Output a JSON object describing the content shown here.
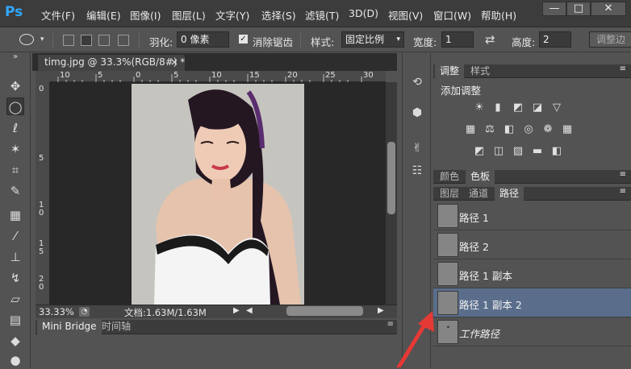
{
  "menubar": {
    "logo": "Ps",
    "items": [
      "文件(F)",
      "编辑(E)",
      "图像(I)",
      "图层(L)",
      "文字(Y)",
      "选择(S)",
      "滤镜(T)",
      "3D(D)",
      "视图(V)",
      "窗口(W)",
      "帮助(H)"
    ],
    "window_buttons": [
      "—",
      "□",
      "✕"
    ]
  },
  "options": {
    "feather_label": "羽化:",
    "feather_value": "0 像素",
    "antialias_label": "消除锯齿",
    "style_label": "样式:",
    "style_value": "固定比例",
    "width_label": "宽度:",
    "width_value": "1",
    "height_label": "高度:",
    "height_value": "2",
    "adjust_edge": "调整边"
  },
  "document": {
    "tab_title": "timg.jpg @ 33.3%(RGB/8#) *",
    "close": "×",
    "ruler_top": [
      "10",
      "5",
      "0",
      "5",
      "10",
      "15",
      "20",
      "25",
      "30"
    ],
    "ruler_left": [
      "0",
      "5",
      "1 0",
      "1 5",
      "2 0"
    ],
    "zoom": "33.33%",
    "doc_info": "文档:1.63M/1.63M"
  },
  "bottom_panel": {
    "tabs": [
      "Mini Bridge",
      "时间轴"
    ]
  },
  "adjust_panel": {
    "tabs": [
      "调整",
      "样式"
    ],
    "title": "添加调整"
  },
  "color_panel": {
    "tabs": [
      "颜色",
      "色板"
    ]
  },
  "paths_panel": {
    "tabs": [
      "图层",
      "通道",
      "路径"
    ],
    "paths": [
      {
        "label": "路径 1",
        "italic": false,
        "selected": false
      },
      {
        "label": "路径 2",
        "italic": false,
        "selected": false
      },
      {
        "label": "路径 1 副本",
        "italic": false,
        "selected": false
      },
      {
        "label": "路径 1 副本 2",
        "italic": false,
        "selected": true
      },
      {
        "label": "工作路径",
        "italic": true,
        "selected": false
      }
    ]
  },
  "colors": {
    "selected_row": "#5a6e8c",
    "arrow": "#e53935",
    "logo": "#31a8ff"
  }
}
